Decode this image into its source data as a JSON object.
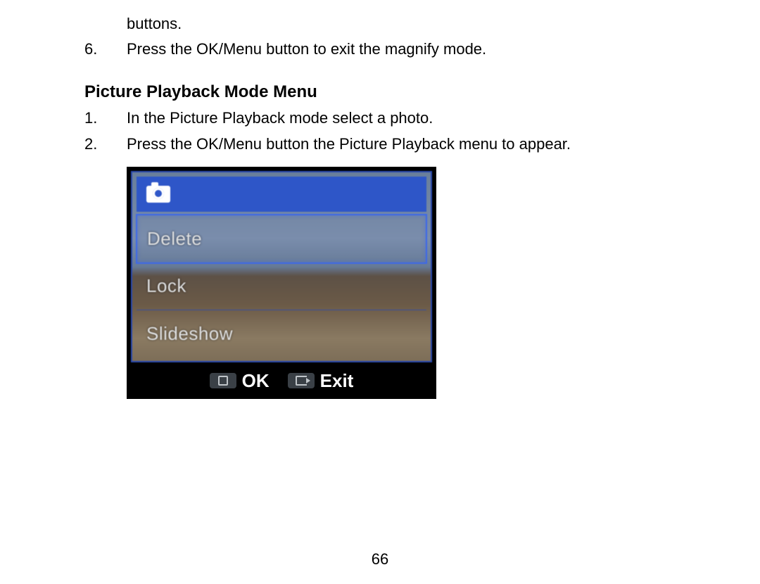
{
  "continuation_line": "buttons.",
  "prev_list_item": {
    "num": "6.",
    "text": "Press the OK/Menu button to exit the magnify mode."
  },
  "section_heading": "Picture Playback Mode Menu",
  "steps": [
    {
      "num": "1.",
      "text": "In the Picture Playback mode select a photo."
    },
    {
      "num": "2.",
      "text": "Press the OK/Menu button the Picture Playback menu to appear."
    }
  ],
  "camera_menu": {
    "items": [
      "Delete",
      "Lock",
      "Slideshow"
    ],
    "selected_index": 0,
    "footer": {
      "ok_label": "OK",
      "exit_label": "Exit"
    }
  },
  "page_number": "66"
}
